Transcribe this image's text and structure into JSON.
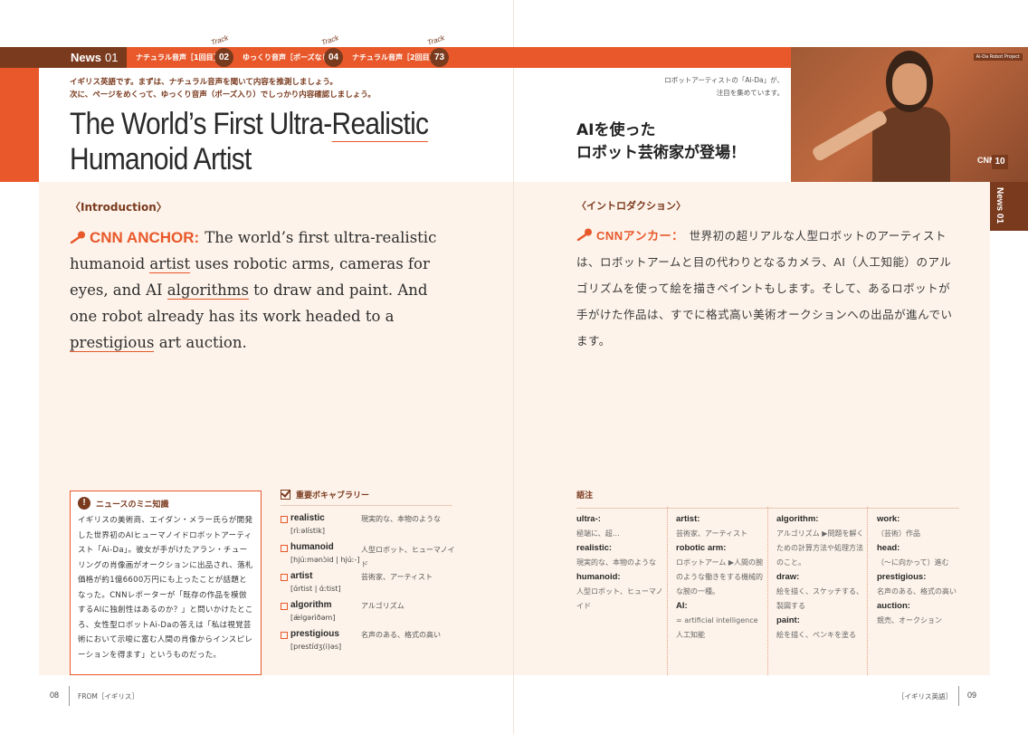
{
  "header": {
    "news_label": "News",
    "news_number": "01",
    "tracks": [
      {
        "label": "ナチュラル音声［1回目］",
        "track_word": "Track",
        "number": "02"
      },
      {
        "label": "ゆっくり音声［ポーズなし］",
        "track_word": "Track",
        "number": "04"
      },
      {
        "label": "ナチュラル音声［2回目］",
        "track_word": "Track",
        "number": "73"
      }
    ],
    "instruction_line1": "イギリス英語です。まずは、ナチュラル音声を聞いて内容を推測しましょう。",
    "instruction_line2": "次に、ページをめくって、ゆっくり音声（ポーズ入り）でしっかり内容確認しましょう。",
    "title_en_line1_a": "The World’s First Ultra-",
    "title_en_line1_b": "Realistic",
    "title_en_line2": "Humanoid Artist",
    "caption_line1": "ロボットアーティストの「Ai-Da」が、",
    "caption_line2": "注目を集めています。",
    "title_ja_line1": "AIを使った",
    "title_ja_line2": "ロボット芸術家が登場！",
    "photo_credit": "Ai-Da Robot Project",
    "cnn_logo": "CNN",
    "cnn_number": "10",
    "side_tab": "News 01"
  },
  "intro": {
    "heading_en": "〈Introduction〉",
    "heading_ja": "〈イントロダクション〉",
    "speaker_en": "CNN ANCHOR:",
    "speaker_ja": "CNNアンカー：",
    "en_1": "The world’s first ultra-realistic humanoid ",
    "en_artist": "artist",
    "en_2": " uses robotic arms, cameras for eyes, and AI ",
    "en_algorithms": "algorithms",
    "en_3": " to draw and paint. And one robot already has its work headed to a ",
    "en_prestigious": "prestigious",
    "en_4": " art auction.",
    "ja_text": "世界初の超リアルな人型ロボットのアーティストは、ロボットアームと目の代わりとなるカメラ、AI（人工知能）のアルゴリズムを使って絵を描きペイントもします。そして、あるロボットが手がけた作品は、すでに格式高い美術オークションへの出品が進んでいます。"
  },
  "mini": {
    "title": "ニュースのミニ知識",
    "body": "イギリスの美術商、エイダン・メラー氏らが開発した世界初のAIヒューマノイドロボットアーティスト「Ai-Da」。彼女が手がけたアラン・チューリングの肖像画がオークションに出品され、落札価格が約1億6600万円にも上ったことが話題となった。CNNレポーターが「既存の作品を模倣するAIに独創性はあるのか？」と問いかけたところ、女性型ロボットAi-Daの答えは「私は視覚芸術において示唆に富む人間の肖像からインスピレーションを得ます」というものだった。"
  },
  "vocab": {
    "title": "重要ボキャブラリー",
    "items": [
      {
        "word": "realistic",
        "pron": "[rìːəlístik]",
        "meaning": "現実的な、本物のような"
      },
      {
        "word": "humanoid",
        "pron": "[hjúːmənɔ̀id | hjúː-]",
        "meaning": "人型ロボット、ヒューマノイド"
      },
      {
        "word": "artist",
        "pron": "[ɑ́rtist | ɑ́ːtist]",
        "meaning": "芸術家、アーティスト"
      },
      {
        "word": "algorithm",
        "pron": "[ǽlɡərìðəm]",
        "meaning": "アルゴリズム"
      },
      {
        "word": "prestigious",
        "pron": "[prestídʒ(i)əs]",
        "meaning": "名声のある、格式の高い"
      }
    ]
  },
  "glossary": {
    "title": "語注",
    "columns": [
      [
        {
          "term": "ultra-:",
          "def": "極端に、超…"
        },
        {
          "term": "realistic:",
          "def": "現実的な、本物のような"
        },
        {
          "term": "humanoid:",
          "def": "人型ロボット、ヒューマノイド"
        }
      ],
      [
        {
          "term": "artist:",
          "def": "芸術家、アーティスト"
        },
        {
          "term": "robotic arm:",
          "def": "ロボットアーム ▶人間の腕のような働きをする機械的な腕の一種。"
        },
        {
          "term": "AI:",
          "def": "= artificial intelligence 人工知能"
        }
      ],
      [
        {
          "term": "algorithm:",
          "def": "アルゴリズム ▶問題を解くための計算方法や処理方法のこと。"
        },
        {
          "term": "draw:",
          "def": "絵を描く、スケッチする、製図する"
        },
        {
          "term": "paint:",
          "def": "絵を描く、ペンキを塗る"
        }
      ],
      [
        {
          "term": "work:",
          "def": "（芸術）作品"
        },
        {
          "term": "head:",
          "def": "（〜に向かって）進む"
        },
        {
          "term": "prestigious:",
          "def": "名声のある、格式の高い"
        },
        {
          "term": "auction:",
          "def": "競売、オークション"
        }
      ]
    ]
  },
  "footer": {
    "left_num": "08",
    "left_text": "FROM［イギリス］",
    "right_text": "［イギリス英語］",
    "right_num": "09"
  },
  "colors": {
    "accent": "#e8582a",
    "dark": "#7a3a1e",
    "cream": "#fdf3ea"
  }
}
